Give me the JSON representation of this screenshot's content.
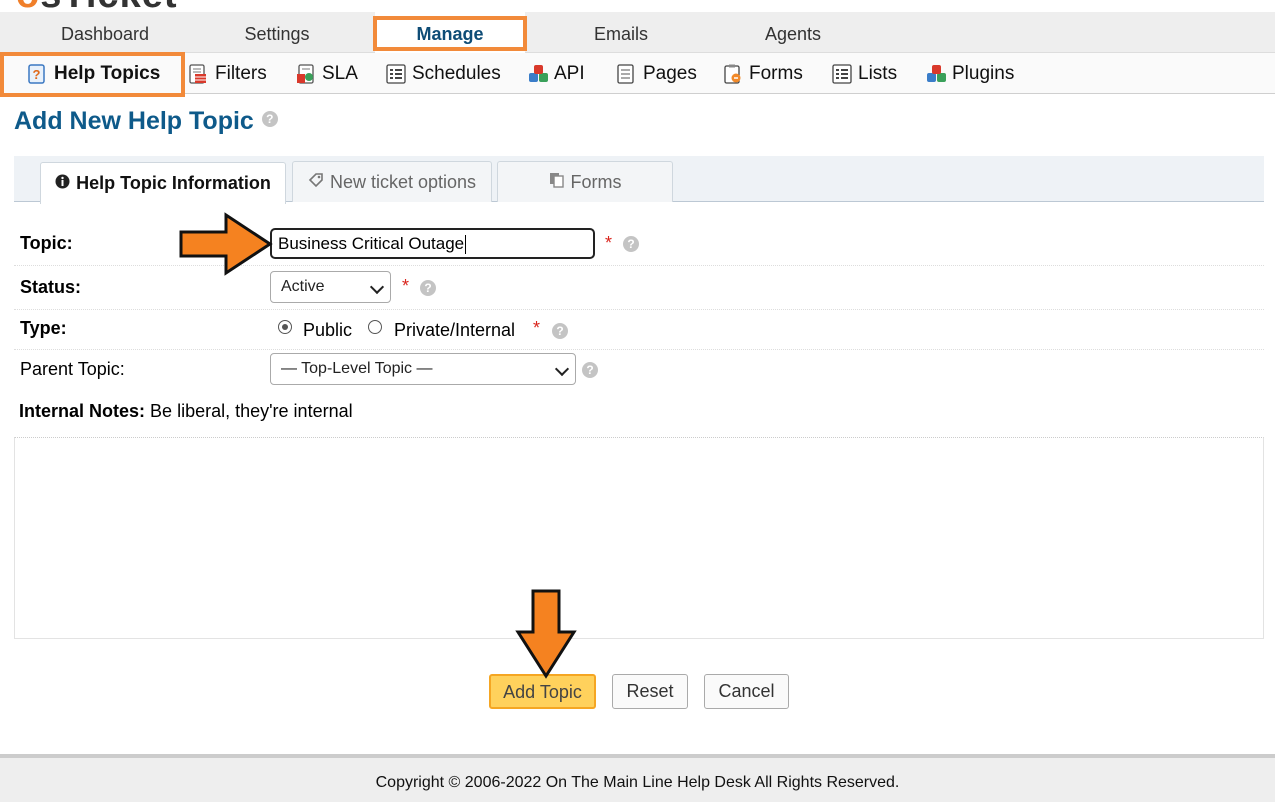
{
  "app": {
    "logo": "osTicket"
  },
  "topnav": {
    "items": [
      "Dashboard",
      "Settings",
      "Manage",
      "Emails",
      "Agents"
    ],
    "active": "Manage"
  },
  "subnav": {
    "items": [
      "Help Topics",
      "Filters",
      "SLA",
      "Schedules",
      "API",
      "Pages",
      "Forms",
      "Lists",
      "Plugins"
    ],
    "active": "Help Topics"
  },
  "page": {
    "title": "Add New Help Topic"
  },
  "tabs": {
    "items": [
      "Help Topic Information",
      "New ticket options",
      "Forms"
    ],
    "active": "Help Topic Information"
  },
  "form": {
    "topic_label": "Topic:",
    "topic_value": "Business Critical Outage",
    "status_label": "Status:",
    "status_value": "Active",
    "type_label": "Type:",
    "type_options": [
      "Public",
      "Private/Internal"
    ],
    "type_selected": "Public",
    "parent_label": "Parent Topic:",
    "parent_value": "— Top-Level Topic —",
    "notes_label": "Internal Notes:",
    "notes_hint": "Be liberal, they're internal",
    "required_mark": "*",
    "help_glyph": "?"
  },
  "buttons": {
    "add": "Add Topic",
    "reset": "Reset",
    "cancel": "Cancel"
  },
  "footer": {
    "copyright": "Copyright © 2006-2022 On The Main Line Help Desk All Rights Reserved."
  },
  "colors": {
    "accent_orange": "#f28a3a",
    "title_blue": "#0e5a8a",
    "required_red": "#d9251d",
    "primary_button": "#ffd15c"
  }
}
